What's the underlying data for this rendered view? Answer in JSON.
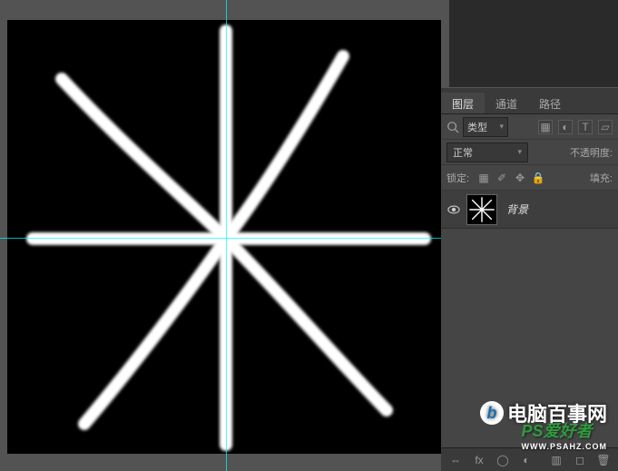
{
  "tabs": {
    "layers": "图层",
    "channels": "通道",
    "paths": "路径"
  },
  "filter": {
    "type_label": "类型"
  },
  "blend": {
    "mode": "正常",
    "opacity_label": "不透明度:"
  },
  "lock": {
    "label": "锁定:",
    "fill_label": "填充:"
  },
  "layers": [
    {
      "name": "背景"
    }
  ],
  "icons": {
    "image_filter": "▦",
    "adjust_filter": "◐",
    "text_filter": "T",
    "shape_filter": "▱",
    "lock_trans": "▦",
    "lock_brush": "✐",
    "lock_move": "✥",
    "lock_all": "🔒",
    "link": "⇔",
    "fx": "fx",
    "mask": "◯",
    "adj": "◐",
    "group": "▥",
    "new": "◻",
    "trash": "🗑"
  },
  "watermarks": {
    "w1": "电脑百事网",
    "w2_main": "PS爱好者",
    "w2_sub": "WWW.PSAHZ.COM"
  }
}
